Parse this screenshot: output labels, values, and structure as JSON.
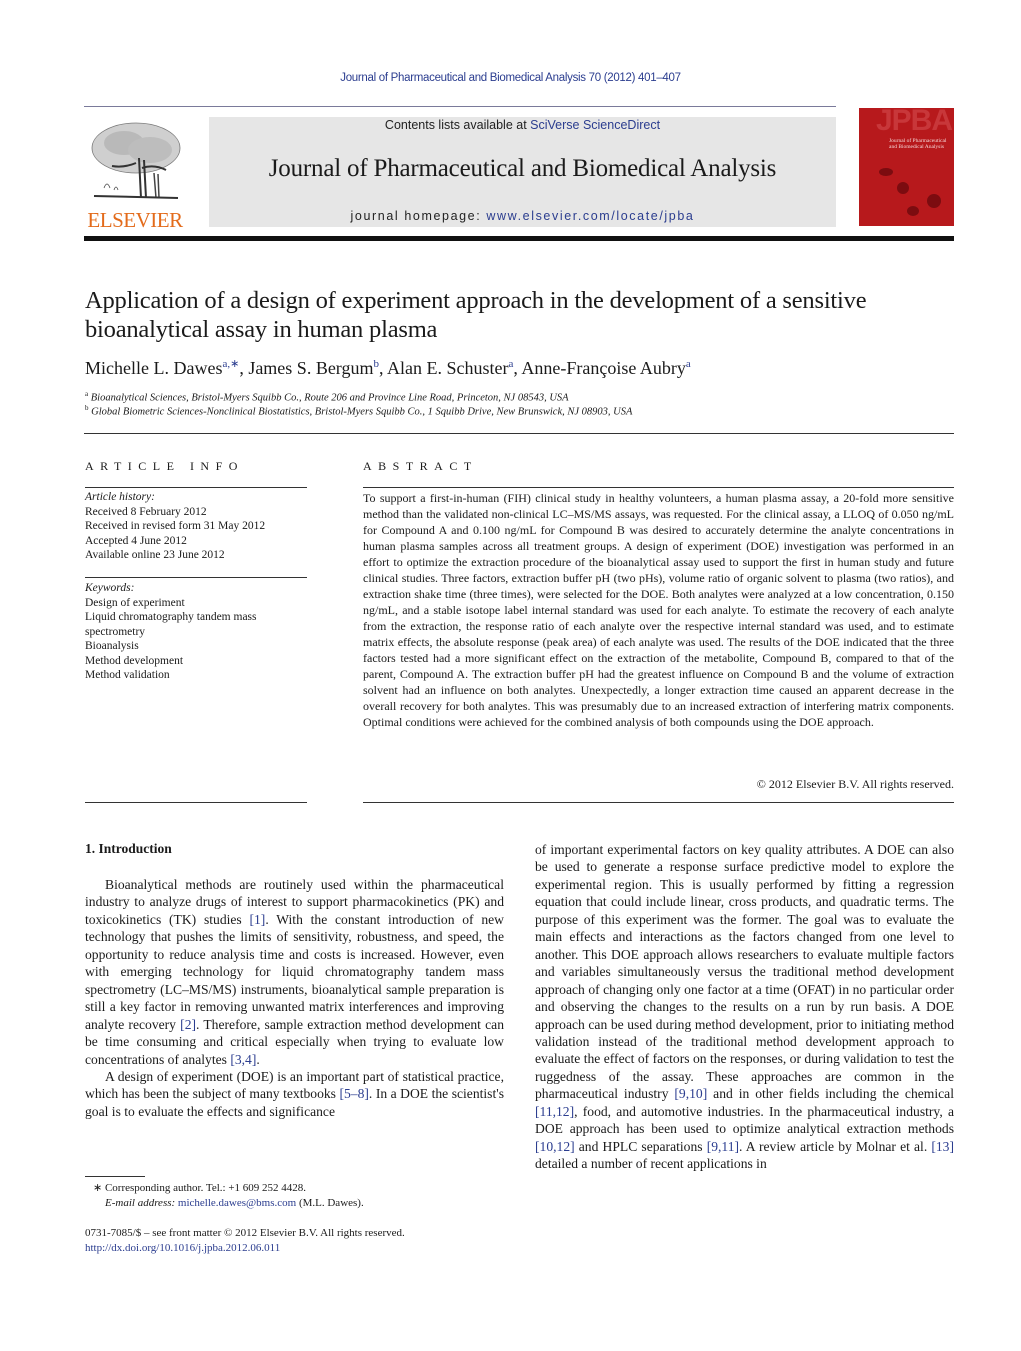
{
  "header": {
    "journal_ref": "Journal of Pharmaceutical and Biomedical Analysis 70 (2012) 401–407",
    "contents_prefix": "Contents lists available at ",
    "contents_link": "SciVerse ScienceDirect",
    "journal_title": "Journal of Pharmaceutical and Biomedical Analysis",
    "homepage_prefix": "journal homepage: ",
    "homepage_link": "www.elsevier.com/locate/jpba",
    "publisher_logo_text": "ELSEVIER",
    "publisher_logo_icon": "tree-icon",
    "cover_text": "JPBA",
    "cover_subtitle_line1": "Journal of Pharmaceutical",
    "cover_subtitle_line2": "and Biomedical Analysis",
    "colors": {
      "link": "#2b3d8f",
      "elsevier_orange": "#e36b1b",
      "masthead_bg": "#e6e6e6",
      "cover_red": "#b7191c"
    }
  },
  "article": {
    "title": "Application of a design of experiment approach in the development of a sensitive bioanalytical assay in human plasma",
    "authors": [
      {
        "name": "Michelle L. Dawes",
        "sup": "a,∗"
      },
      {
        "name": "James S. Bergum",
        "sup": "b"
      },
      {
        "name": "Alan E. Schuster",
        "sup": "a"
      },
      {
        "name": "Anne-Françoise Aubry",
        "sup": "a"
      }
    ],
    "affiliations": [
      {
        "mark": "a",
        "text": "Bioanalytical Sciences, Bristol-Myers Squibb Co., Route 206 and Province Line Road, Princeton, NJ 08543, USA"
      },
      {
        "mark": "b",
        "text": "Global Biometric Sciences-Nonclinical Biostatistics, Bristol-Myers Squibb Co., 1 Squibb Drive, New Brunswick, NJ 08903, USA"
      }
    ]
  },
  "article_info": {
    "heading": "ARTICLE INFO",
    "history_label": "Article history:",
    "history": [
      "Received 8 February 2012",
      "Received in revised form 31 May 2012",
      "Accepted 4 June 2012",
      "Available online 23 June 2012"
    ],
    "keywords_label": "Keywords:",
    "keywords": [
      "Design of experiment",
      "Liquid chromatography tandem mass spectrometry",
      "Bioanalysis",
      "Method development",
      "Method validation"
    ]
  },
  "abstract": {
    "heading": "ABSTRACT",
    "text": "To support a first-in-human (FIH) clinical study in healthy volunteers, a human plasma assay, a 20-fold more sensitive method than the validated non-clinical LC–MS/MS assays, was requested. For the clinical assay, a LLOQ of 0.050 ng/mL for Compound A and 0.100 ng/mL for Compound B was desired to accurately determine the analyte concentrations in human plasma samples across all treatment groups. A design of experiment (DOE) investigation was performed in an effort to optimize the extraction procedure of the bioanalytical assay used to support the first in human study and future clinical studies. Three factors, extraction buffer pH (two pHs), volume ratio of organic solvent to plasma (two ratios), and extraction shake time (three times), were selected for the DOE. Both analytes were analyzed at a low concentration, 0.150 ng/mL, and a stable isotope label internal standard was used for each analyte. To estimate the recovery of each analyte from the extraction, the response ratio of each analyte over the respective internal standard was used, and to estimate matrix effects, the absolute response (peak area) of each analyte was used. The results of the DOE indicated that the three factors tested had a more significant effect on the extraction of the metabolite, Compound B, compared to that of the parent, Compound A. The extraction buffer pH had the greatest influence on Compound B and the volume of extraction solvent had an influence on both analytes. Unexpectedly, a longer extraction time caused an apparent decrease in the overall recovery for both analytes. This was presumably due to an increased extraction of interfering matrix components. Optimal conditions were achieved for the combined analysis of both compounds using the DOE approach.",
    "copyright": "© 2012 Elsevier B.V. All rights reserved."
  },
  "body": {
    "section_heading": "1.  Introduction",
    "left_paragraphs": [
      [
        {
          "t": "Bioanalytical methods are routinely used within the pharmaceutical industry to analyze drugs of interest to support pharmacokinetics (PK) and toxicokinetics (TK) studies "
        },
        {
          "ref": "[1]"
        },
        {
          "t": ". With the constant introduction of new technology that pushes the limits of sensitivity, robustness, and speed, the opportunity to reduce analysis time and costs is increased. However, even with emerging technology for liquid chromatography tandem mass spectrometry (LC–MS/MS) instruments, bioanalytical sample preparation is still a key factor in removing unwanted matrix interferences and improving analyte recovery "
        },
        {
          "ref": "[2]"
        },
        {
          "t": ". Therefore, sample extraction method development can be time consuming and critical especially when trying to evaluate low concentrations of analytes "
        },
        {
          "ref": "[3,4]"
        },
        {
          "t": "."
        }
      ],
      [
        {
          "t": "A design of experiment (DOE) is an important part of statistical practice, which has been the subject of many textbooks "
        },
        {
          "ref": "[5–8]"
        },
        {
          "t": ". In a DOE the scientist's goal is to evaluate the effects and significance"
        }
      ]
    ],
    "right_paragraphs": [
      [
        {
          "t": "of important experimental factors on key quality attributes. A DOE can also be used to generate a response surface predictive model to explore the experimental region. This is usually performed by fitting a regression equation that could include linear, cross products, and quadratic terms. The purpose of this experiment was the former. The goal was to evaluate the main effects and interactions as the factors changed from one level to another. This DOE approach allows researchers to evaluate multiple factors and variables simultaneously versus the traditional method development approach of changing only one factor at a time (OFAT) in no particular order and observing the changes to the results on a run by run basis. A DOE approach can be used during method development, prior to initiating method validation instead of the traditional method development approach to evaluate the effect of factors on the responses, or during validation to test the ruggedness of the assay. These approaches are common in the pharmaceutical industry "
        },
        {
          "ref": "[9,10]"
        },
        {
          "t": " and in other fields including the chemical "
        },
        {
          "ref": "[11,12]"
        },
        {
          "t": ", food, and automotive industries. In the pharmaceutical industry, a DOE approach has been used to optimize analytical extraction methods "
        },
        {
          "ref": "[10,12]"
        },
        {
          "t": " and HPLC separations "
        },
        {
          "ref": "[9,11]"
        },
        {
          "t": ". A review article by Molnar et al. "
        },
        {
          "ref": "[13]"
        },
        {
          "t": " detailed a number of recent applications in"
        }
      ]
    ]
  },
  "footnotes": {
    "corresponding": "∗ Corresponding author. Tel.: +1 609 252 4428.",
    "email_label": "E-mail address: ",
    "email": "michelle.dawes@bms.com",
    "email_suffix": " (M.L. Dawes).",
    "front_matter": "0731-7085/$ – see front matter © 2012 Elsevier B.V. All rights reserved.",
    "doi": "http://dx.doi.org/10.1016/j.jpba.2012.06.011"
  }
}
